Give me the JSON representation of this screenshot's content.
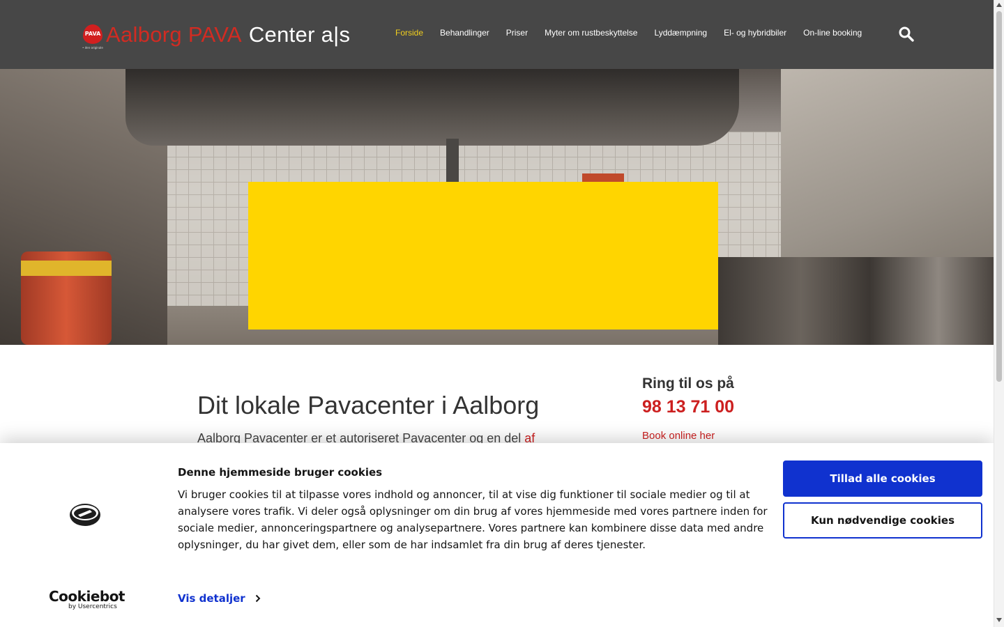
{
  "header": {
    "logo": {
      "badge_text": "PAVA",
      "tagline": "• den originale",
      "name_red": "Aalborg PAVA",
      "name_white": "Center a|s"
    },
    "nav": [
      {
        "label": "Forside",
        "active": true
      },
      {
        "label": "Behandlinger",
        "active": false
      },
      {
        "label": "Priser",
        "active": false
      },
      {
        "label": "Myter om rustbeskyttelse",
        "active": false
      },
      {
        "label": "Lyddæmpning",
        "active": false
      },
      {
        "label": "El- og hybridbiler",
        "active": false
      },
      {
        "label": "On-line booking",
        "active": false
      }
    ],
    "search_icon": "search-icon"
  },
  "content": {
    "title": "Dit lokale Pavacenter i Aalborg",
    "intro_text": "Aalborg Pavacenter er et autoriseret Pavacenter og en del ",
    "intro_link": "af",
    "call_label": "Ring til os på",
    "phone": "98 13 71 00",
    "book_link": "Book online her"
  },
  "cookie_banner": {
    "title": "Denne hjemmeside bruger cookies",
    "text": "Vi bruger cookies til at tilpasse vores indhold og annoncer, til at vise dig funktioner til sociale medier og til at analysere vores trafik. Vi deler også oplysninger om din brug af vores hjemmeside med vores partnere inden for sociale medier, annonceringspartnere og analysepartnere. Vores partnere kan kombinere disse data med andre oplysninger, du har givet dem, eller som de har indsamlet fra din brug af deres tjenester.",
    "details_label": "Vis detaljer",
    "allow_all_label": "Tillad alle cookies",
    "necessary_only_label": "Kun nødvendige cookies",
    "brand": "Cookiebot",
    "brand_sub": "by Usercentrics"
  },
  "colors": {
    "header_bg": "#474747",
    "nav_active": "#f2cf1e",
    "accent_red": "#cc1f1f",
    "cookie_blue": "#1032cf",
    "hero_box": "#ffd500"
  }
}
